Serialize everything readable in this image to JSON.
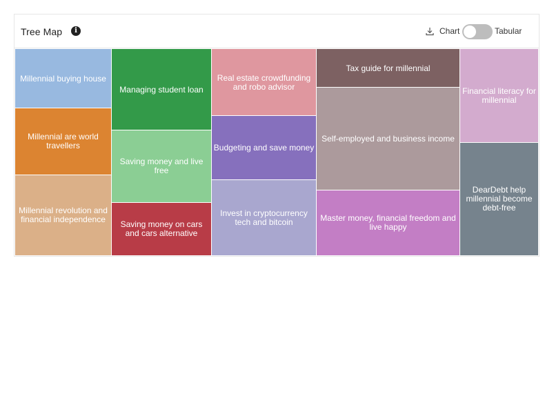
{
  "header": {
    "title": "Tree Map",
    "info_icon": "info-icon",
    "download_icon": "download-icon",
    "chart_label": "Chart",
    "tabular_label": "Tabular",
    "toggle_state": "Chart"
  },
  "chart_data": {
    "type": "treemap",
    "items": [
      {
        "label": "Millennial buying house",
        "color": "#98b9e0"
      },
      {
        "label": "Millennial are world travellers",
        "color": "#dc8431"
      },
      {
        "label": "Millennial revolution and financial independence",
        "color": "#dbb088"
      },
      {
        "label": "Managing student loan",
        "color": "#339a49"
      },
      {
        "label": "Saving money and live free",
        "color": "#8bce94"
      },
      {
        "label": "Saving money on cars and cars alternative",
        "color": "#b83c47"
      },
      {
        "label": "Real estate crowdfunding and robo advisor",
        "color": "#df979f"
      },
      {
        "label": "Budgeting and save money",
        "color": "#8670bd"
      },
      {
        "label": "Invest in cryptocurrency tech and bitcoin",
        "color": "#a9a7cf"
      },
      {
        "label": "Tax guide for millennial",
        "color": "#7d6162"
      },
      {
        "label": "Self-employed and business income",
        "color": "#ac9a9c"
      },
      {
        "label": "Master money, financial freedom and live happy",
        "color": "#c37ec5"
      },
      {
        "label": "Financial literacy for millennial",
        "color": "#d3abce"
      },
      {
        "label": "DearDebt help millennial become debt-free",
        "color": "#76838d"
      }
    ]
  }
}
